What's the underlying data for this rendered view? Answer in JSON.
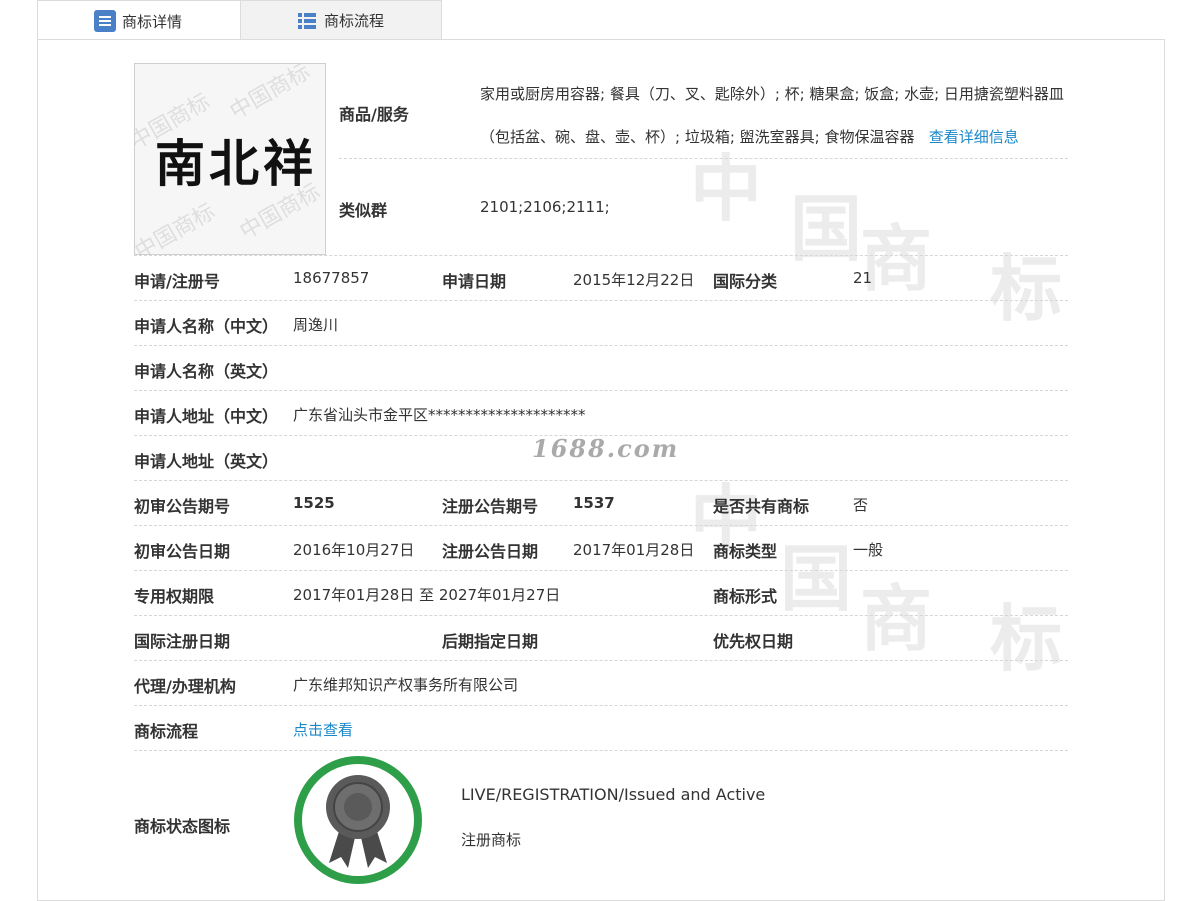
{
  "tabs": [
    {
      "label": "商标详情",
      "icon": "list-doc-icon"
    },
    {
      "label": "商标流程",
      "icon": "grid-list-icon"
    }
  ],
  "logo": {
    "text": "南北祥",
    "watermark": "中国商标"
  },
  "goods": {
    "label": "商品/服务",
    "value": "家用或厨房用容器; 餐具（刀、叉、匙除外）; 杯; 糖果盒; 饭盒; 水壶; 日用搪瓷塑料器皿（包括盆、碗、盘、壶、杯）; 垃圾箱; 盥洗室器具; 食物保温容器",
    "detail_link": "查看详细信息"
  },
  "similar_group": {
    "label": "类似群",
    "value": "2101;2106;2111;"
  },
  "rows": {
    "reg_no_label": "申请/注册号",
    "reg_no": "18677857",
    "apply_date_label": "申请日期",
    "apply_date": "2015年12月22日",
    "intl_class_label": "国际分类",
    "intl_class": "21",
    "applicant_cn_label": "申请人名称（中文）",
    "applicant_cn": "周逸川",
    "applicant_en_label": "申请人名称（英文）",
    "applicant_en": "",
    "address_cn_label": "申请人地址（中文）",
    "address_cn": "广东省汕头市金平区*********************",
    "address_en_label": "申请人地址（英文）",
    "address_en": "",
    "prelim_issue_label": "初审公告期号",
    "prelim_issue": "1525",
    "reg_issue_label": "注册公告期号",
    "reg_issue": "1537",
    "shared_label": "是否共有商标",
    "shared": "否",
    "prelim_date_label": "初审公告日期",
    "prelim_date": "2016年10月27日",
    "reg_date_label": "注册公告日期",
    "reg_date": "2017年01月28日",
    "tm_type_label": "商标类型",
    "tm_type": "一般",
    "excl_period_label": "专用权期限",
    "excl_period": "2017年01月28日 至 2027年01月27日",
    "tm_form_label": "商标形式",
    "tm_form": "",
    "intl_reg_date_label": "国际注册日期",
    "intl_reg_date": "",
    "later_date_label": "后期指定日期",
    "later_date": "",
    "priority_date_label": "优先权日期",
    "priority_date": "",
    "agent_label": "代理/办理机构",
    "agent": "广东维邦知识产权事务所有限公司",
    "process_label": "商标流程",
    "process_link": "点击查看",
    "status_icon_label": "商标状态图标"
  },
  "status": {
    "en": "LIVE/REGISTRATION/Issued and Active",
    "cn": "注册商标",
    "ring_color": "#2e9e48"
  },
  "site_mark": "1688.com"
}
